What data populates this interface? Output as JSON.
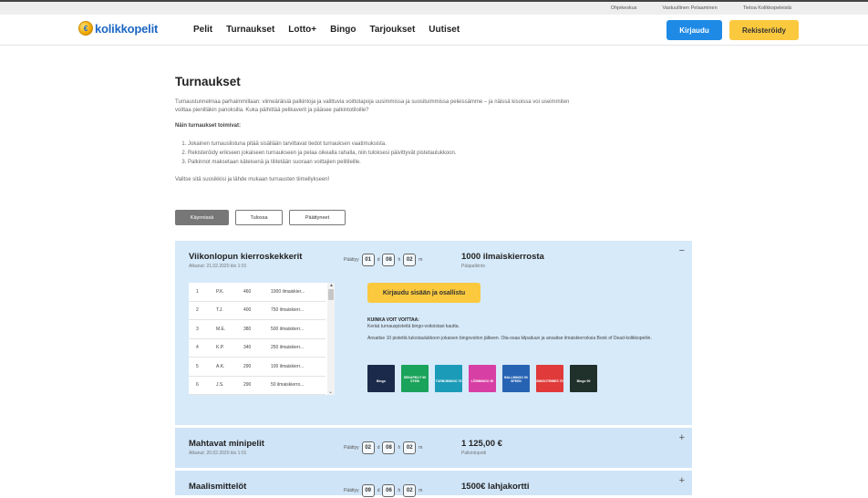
{
  "topbar": {
    "links": [
      "Ohjekeskus",
      "Vastuullinen Pelaaminen",
      "Tietoa Kolikkopeleistä"
    ]
  },
  "logo": {
    "text": "kolikkopelit"
  },
  "nav": [
    "Pelit",
    "Turnaukset",
    "Lotto+",
    "Bingo",
    "Tarjoukset",
    "Uutiset"
  ],
  "auth": {
    "login": "Kirjaudu",
    "register": "Rekisteröidy"
  },
  "page": {
    "title": "Turnaukset",
    "intro": "Turnaustunnelmaa parhaimmillaan: viimeäräisiä palkintoja ja valittuvia voittotapoja uusimmissa ja suosituimmissa peleissämme – ja näissä kisoissa voi useimmiten voittaa pienilläkin panoksilla. Kuka päihittää pelikaverit ja pääsee palkintotiloille?",
    "howto_title": "Näin turnaukset toimivat:",
    "steps": [
      "Jokainen turnauslistuna pitää sisällään tarvittavat tiedot turnauksen vaatimuksista.",
      "Rekisteröidy erikseen jokaiseen turnaukseen ja pelaa oikealla rahalla, niin tuloksesi päivittyvät pistetaulukkoon.",
      "Palkinnot maksetaan käteisenä ja tilitetään suoraan voittajien pelitileille."
    ],
    "outro": "Valitse sitä suosikkisi ja lähde mukaan turnausten tiimellykseen!"
  },
  "tabs": [
    "Käynnissä",
    "Tulossa",
    "Päättyneet"
  ],
  "tournaments": [
    {
      "title": "Viikonlopun kierroskekkerit",
      "date": "Alkanut: 21.02.2020 klo 1:01",
      "ends_label": "Päättyy",
      "timer": [
        {
          "value": "01",
          "unit": "d"
        },
        {
          "value": "08",
          "unit": "h"
        },
        {
          "value": "02",
          "unit": "m"
        }
      ],
      "prize": "1000 ilmaiskierrosta",
      "prize_label": "Pääpalkinto",
      "toggle": "−",
      "leaderboard": [
        {
          "rank": "1",
          "name": "P.K.",
          "points": "460",
          "prize": "1000 ilmaiskier..."
        },
        {
          "rank": "2",
          "name": "T.J.",
          "points": "400",
          "prize": "750 ilmaiskierr..."
        },
        {
          "rank": "3",
          "name": "M.E.",
          "points": "380",
          "prize": "500 ilmaiskierr..."
        },
        {
          "rank": "4",
          "name": "K.P.",
          "points": "340",
          "prize": "250 ilmaiskierr..."
        },
        {
          "rank": "5",
          "name": "A.K.",
          "points": "290",
          "prize": "100 ilmaiskierr..."
        },
        {
          "rank": "6",
          "name": "J.S.",
          "points": "290",
          "prize": "50 ilmaiskierro..."
        }
      ],
      "join_label": "Kirjaudu sisään ja osallistu",
      "how_to_win": "KUINKA VOIT VOITTAA:",
      "desc1": "Kerää turnauspisteitä bingo-voitoistasi kautta.",
      "desc2": "Ansaitse 10 pistettä tulostaulukkoon jokaisen bingovoiton jälkeen. Ota-osaa kilpailuun ja ansaitse ilmaiskierroksia Book of Dead-kolikkopeliin.",
      "games": [
        {
          "label": "Bingo",
          "color": "#1b2a4a"
        },
        {
          "label": "SEKAPELIT 60 STEM",
          "color": "#1aa35a"
        },
        {
          "label": "TURBOBINGO 75",
          "color": "#1b9bb8"
        },
        {
          "label": "LÖRIBINGO 90",
          "color": "#d83fa4"
        },
        {
          "label": "BALLBINGO 90 SPEED",
          "color": "#2663b3"
        },
        {
          "label": "BINGOTRIBES 75",
          "color": "#e03a3a"
        },
        {
          "label": "Bingo 90",
          "color": "#20302a"
        }
      ]
    },
    {
      "title": "Mahtavat minipelit",
      "date": "Alkanut: 20.02.2020 klo 1:01",
      "ends_label": "Päättyy",
      "timer": [
        {
          "value": "02",
          "unit": "d"
        },
        {
          "value": "08",
          "unit": "h"
        },
        {
          "value": "02",
          "unit": "m"
        }
      ],
      "prize": "1 125,00 €",
      "prize_label": "Palkintopotti",
      "toggle": "+"
    },
    {
      "title": "Maalismittelöt",
      "ends_label": "Päättyy",
      "timer": [
        {
          "value": "09",
          "unit": "d"
        },
        {
          "value": "06",
          "unit": "h"
        },
        {
          "value": "02",
          "unit": "m"
        }
      ],
      "prize": "1500€ lahjakortti",
      "toggle": "+"
    }
  ]
}
